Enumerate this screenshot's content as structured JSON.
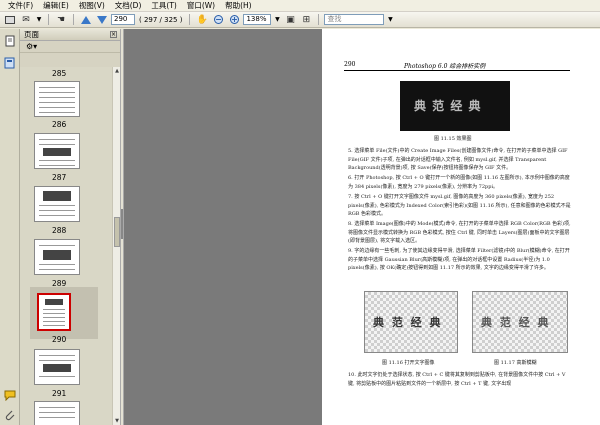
{
  "menu": [
    "文件(F)",
    "编辑(E)",
    "视图(V)",
    "文档(D)",
    "工具(T)",
    "窗口(W)",
    "帮助(H)"
  ],
  "toolbar": {
    "page_value": "290",
    "page_count": "( 297 / 325 )",
    "zoom_value": "138%",
    "search_placeholder": "查找"
  },
  "panel": {
    "title": "页面",
    "options_icon": "gear-icon"
  },
  "thumbnails": [
    {
      "label": "285"
    },
    {
      "label": "286"
    },
    {
      "label": "287"
    },
    {
      "label": "288"
    },
    {
      "label": "289"
    },
    {
      "label": "290",
      "selected": true
    },
    {
      "label": "291"
    }
  ],
  "document": {
    "page_number": "290",
    "running_title": "Photoshop 6.0 综合排析实例",
    "fig_top_text": "典 范 经 典",
    "fig_top_caption": "图 11.15   效果图",
    "paragraphs": [
      "5. 选择菜单 File(文件)中的 Create Image Files(创建图像文件)命令, 在打开的子菜单中选择 GIF File(GIF 文件)子项, 在弹出的对话框中输入文件名, 例如 mysl.gif, 并选择 Transparent Background(透明背景)项, 按 Save(保存)按钮将图像保存为 GIF 文件。",
      "6. 打开 Photoshop, 按 Ctrl + O 键打开一个新的图像(如图 11.16 左图所示), 本示例中图像的高度为 384 pixels(像素), 宽度为 279 pixels(像素), 分辨率为 72ppi。",
      "7. 按 Ctrl + O 键打开文字图像文件 mysl.gif, 图像的高度为 360 pixels(像素), 宽度为 252 pixels(像素), 色彩模式为 Indexed Color(索引色彩)(如图 11.16 所示), 任意和图像的色彩模式不是 RGB 色彩模式。",
      "8. 选择菜单 Image(图像)中的 Mode(模式)命令, 在打开的子菜单中选择 RGB Color(RGB 色彩)项, 将图像文件显示模式转换为 RGB 色彩模式, 按住 Ctrl 键, 同时单击 Layers(图层)面板中的文字图层(即背景图层), 将文字载入选区。",
      "9. 字的边缘有一些毛刺, 为了使其边缘变得平滑, 选择菜单 Filter(滤镜)中的 Blur(模糊)命令, 在打开的子菜单中选择 Gaussian Blur(高斯模糊)项, 在弹出的对话框中设置 Radius(半径)为 1.0 pixels(像素), 按 OK(确定)按钮得到如图 11.17 所示的效果, 文字的边缘变得平滑了许多。"
    ],
    "fig_left_caption": "图 11.16   打开文字图像",
    "fig_right_caption": "图 11.17   高斯模糊",
    "fig_chars": "典 范 经 典",
    "para_bottom": "10. 此时文字仍处于选择状态, 按 Ctrl + C 键将其复制到剪贴板中, 在背景图像文件中按 Ctrl + V 键, 将剪贴板中的图片粘贴到文件的一个新层中, 按 Ctrl + T 键, 文字出现"
  },
  "colors": {
    "selection_border": "#cc0000",
    "doc_background": "#7a7a7a"
  }
}
